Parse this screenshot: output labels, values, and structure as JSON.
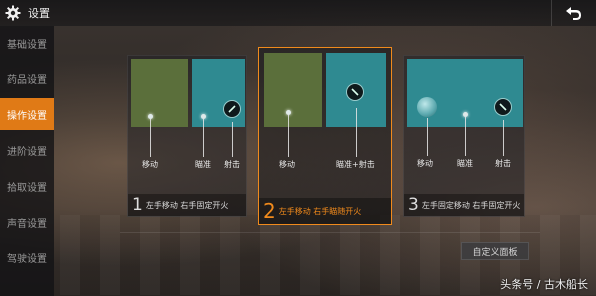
{
  "header": {
    "title": "设置",
    "settings_icon": "gear-icon",
    "back_icon": "return-arrow-icon"
  },
  "sidebar": {
    "items": [
      {
        "label": "基础设置",
        "active": false
      },
      {
        "label": "药品设置",
        "active": false
      },
      {
        "label": "操作设置",
        "active": true
      },
      {
        "label": "进阶设置",
        "active": false
      },
      {
        "label": "拾取设置",
        "active": false
      },
      {
        "label": "声音设置",
        "active": false
      },
      {
        "label": "驾驶设置",
        "active": false
      }
    ]
  },
  "modes": [
    {
      "number": "1",
      "description": "左手移动 右手固定开火",
      "labels": {
        "move": "移动",
        "aim": "瞄准",
        "fire": "射击"
      },
      "selected": false
    },
    {
      "number": "2",
      "description": "左手移动 右手瞄随开火",
      "labels": {
        "move": "移动",
        "aim_fire": "瞄准+射击"
      },
      "selected": true
    },
    {
      "number": "3",
      "description": "左手固定移动 右手固定开火",
      "labels": {
        "move": "移动",
        "aim": "瞄准",
        "fire": "射击"
      },
      "selected": false
    }
  ],
  "custom_layout_button": "自定义面板",
  "watermark": "头条号 / 古木船长",
  "colors": {
    "accent": "#e07a16",
    "zone_green": "#5b6f3b",
    "zone_teal": "#2f8a91"
  }
}
